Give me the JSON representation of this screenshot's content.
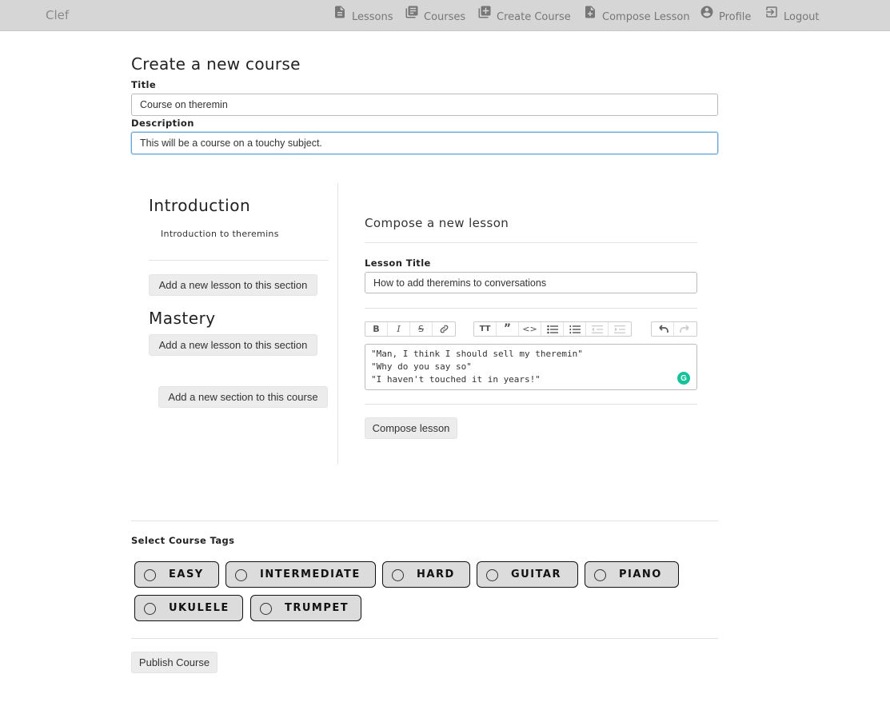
{
  "navbar": {
    "brand": "Clef",
    "items": [
      {
        "label": "Lessons",
        "icon": "document-icon"
      },
      {
        "label": "Courses",
        "icon": "library-icon"
      },
      {
        "label": "Create Course",
        "icon": "add-box-icon"
      },
      {
        "label": "Compose Lesson",
        "icon": "add-document-icon"
      },
      {
        "label": "Profile",
        "icon": "account-circle-icon"
      },
      {
        "label": "Logout",
        "icon": "logout-icon"
      }
    ]
  },
  "form": {
    "heading": "Create a new course",
    "title_label": "Title",
    "title_value": "Course on theremin",
    "description_label": "Description",
    "description_value": "This will be a course on a touchy subject."
  },
  "sections": [
    {
      "name": "Introduction",
      "lessons": [
        "Introduction to theremins"
      ],
      "add_lesson_label": "Add a new lesson to this section"
    },
    {
      "name": "Mastery",
      "lessons": [],
      "add_lesson_label": "Add a new lesson to this section"
    }
  ],
  "add_section_label": "Add a new section to this course",
  "compose": {
    "heading": "Compose a new lesson",
    "lesson_title_label": "Lesson Title",
    "lesson_title_value": "How to add theremins to conversations",
    "toolbar": {
      "format": [
        "bold",
        "italic",
        "strikethrough",
        "link"
      ],
      "blocks": [
        "heading",
        "quote",
        "code",
        "bullet-list",
        "numbered-list",
        "decrease-indent",
        "increase-indent"
      ],
      "history": [
        "undo",
        "redo"
      ]
    },
    "editor_lines": [
      "\"Man, I think I should sell my theremin\"",
      "\"Why do you say so\"",
      "\"I haven't touched it in years!\""
    ],
    "submit_label": "Compose lesson"
  },
  "tags": {
    "label": "Select Course Tags",
    "items": [
      "EASY",
      "INTERMEDIATE",
      "HARD",
      "GUITAR",
      "PIANO",
      "UKULELE",
      "TRUMPET"
    ]
  },
  "publish_label": "Publish Course",
  "colors": {
    "navbar_bg": "#d6d6d6",
    "tag_bg": "#dcdcdc",
    "focus_border": "#6aa5d8",
    "grammarly": "#15c39a"
  }
}
